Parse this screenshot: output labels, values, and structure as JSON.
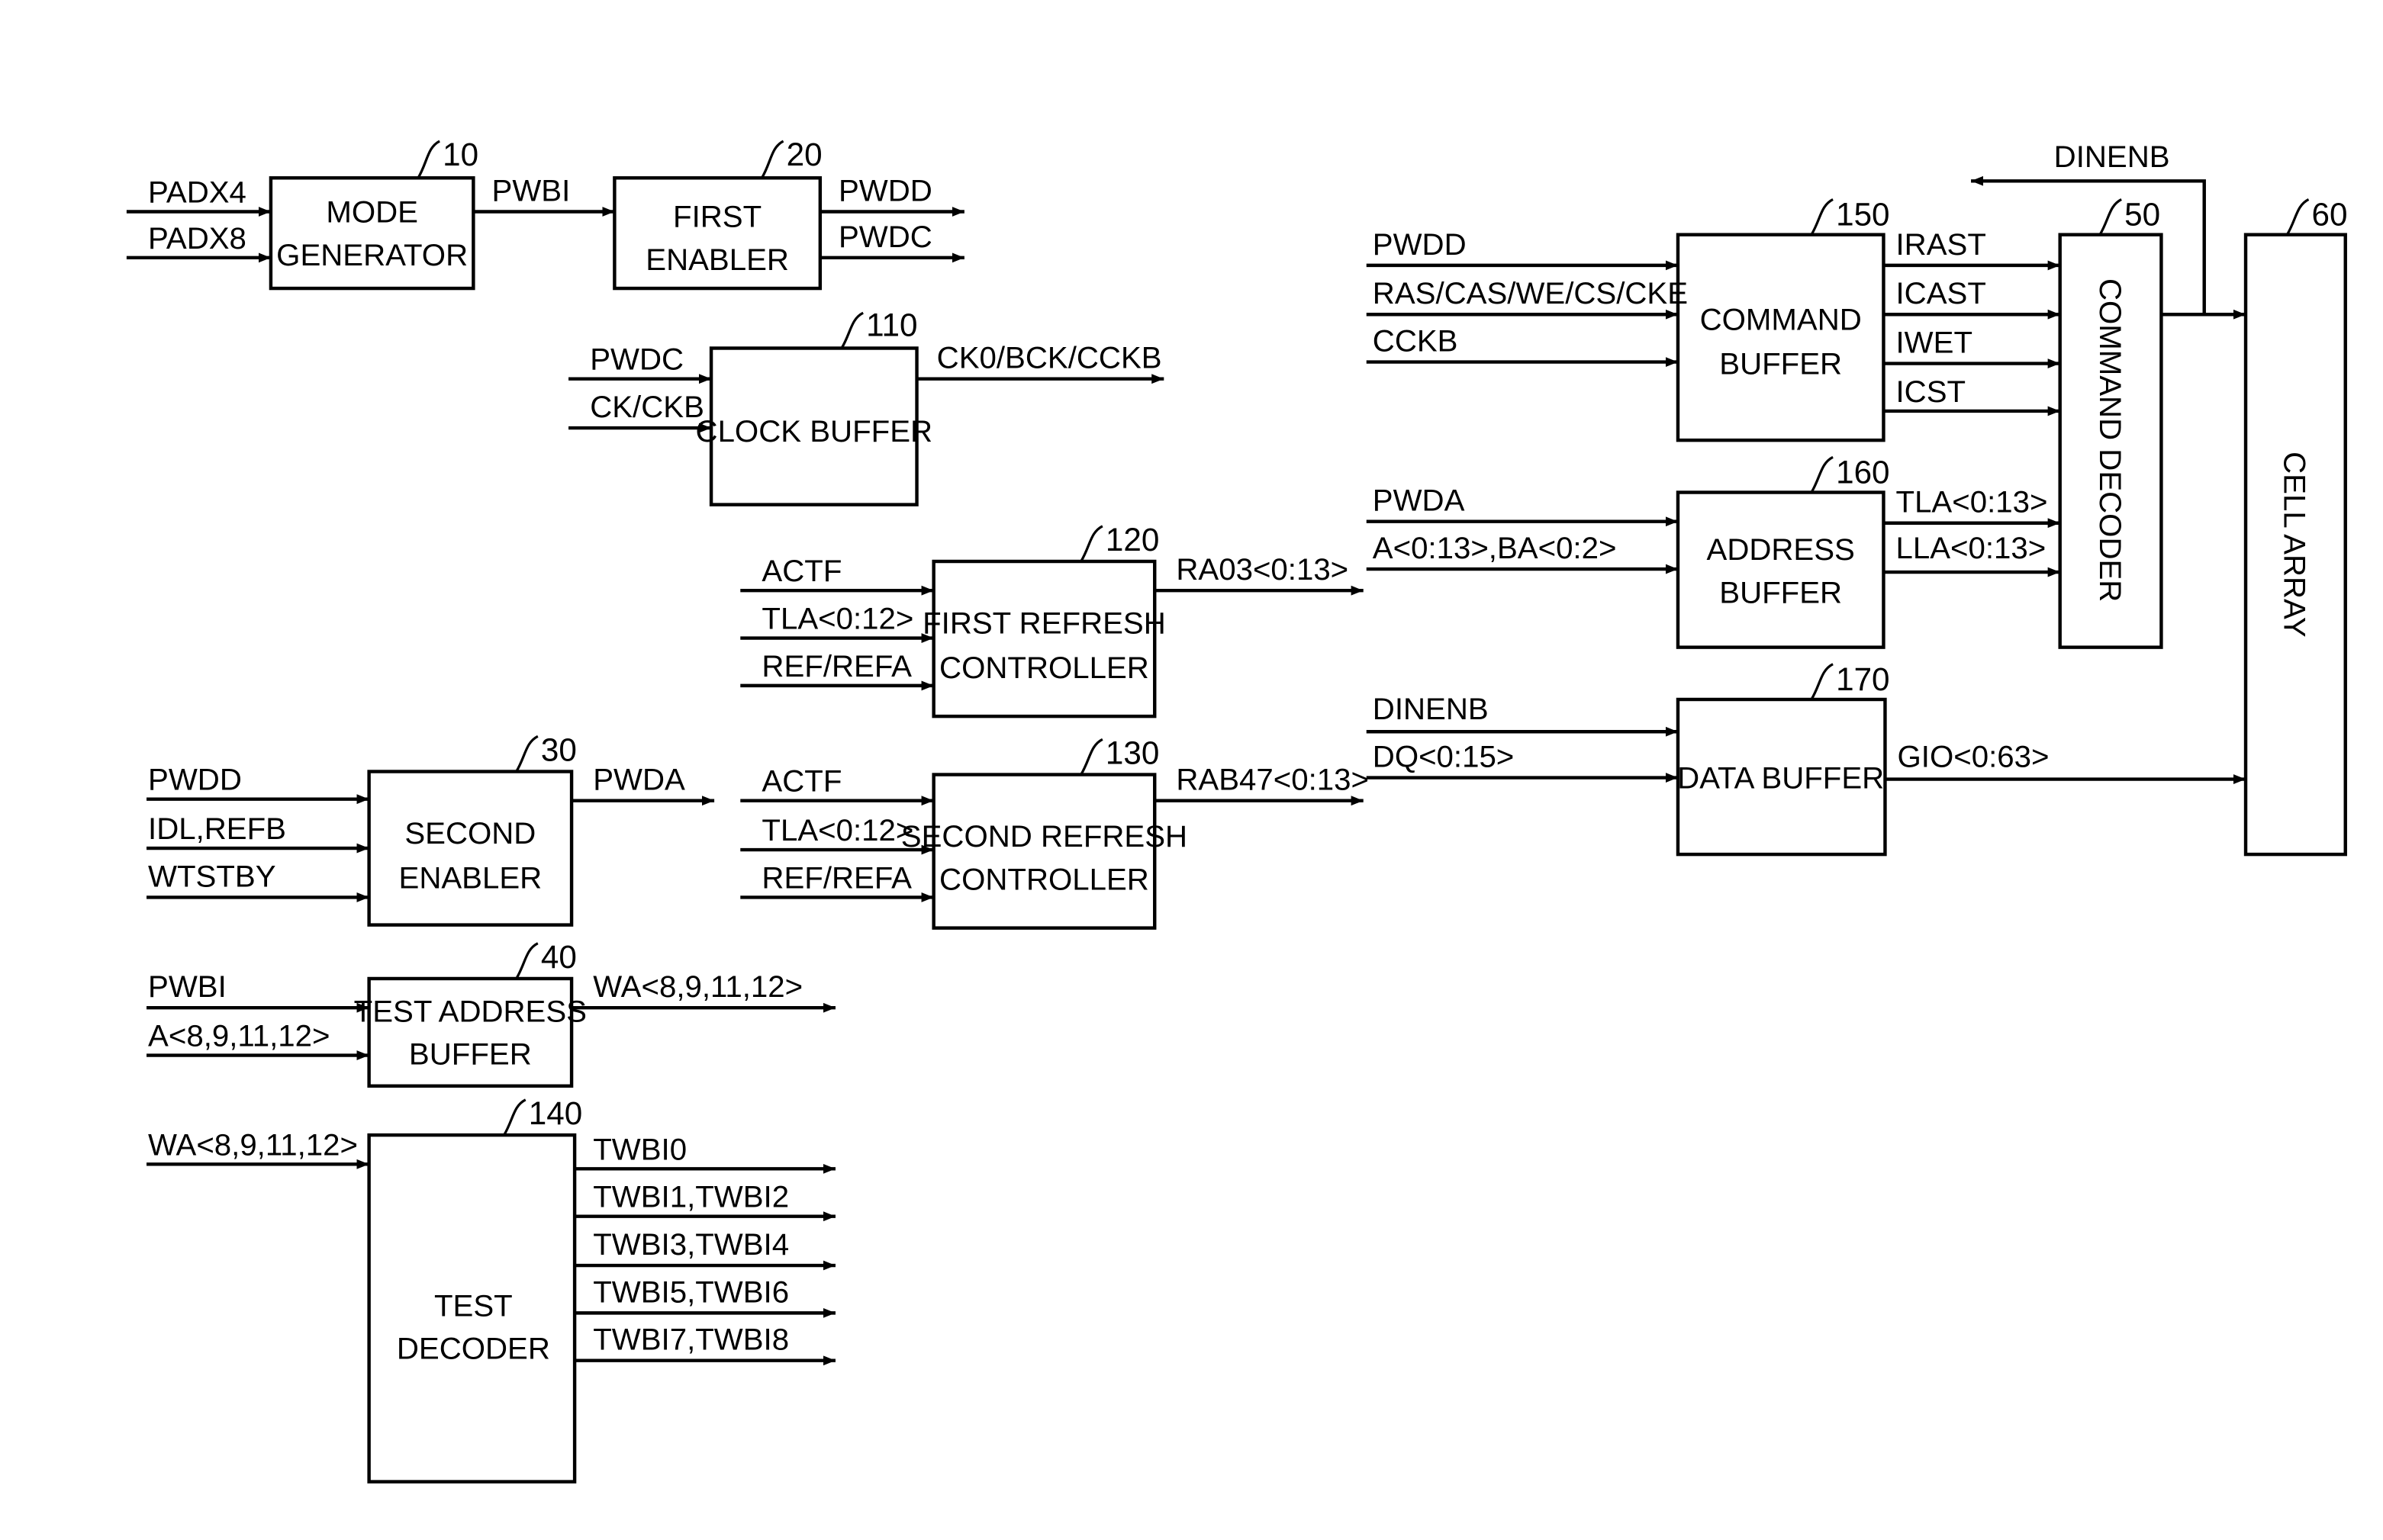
{
  "figure": {
    "blocks": [
      {
        "id": "10",
        "lines": [
          "MODE",
          "GENERATOR"
        ]
      },
      {
        "id": "20",
        "lines": [
          "FIRST",
          "ENABLER"
        ]
      },
      {
        "id": "110",
        "lines": [
          "CLOCK BUFFER"
        ]
      },
      {
        "id": "120",
        "lines": [
          "FIRST REFRESH",
          "CONTROLLER"
        ]
      },
      {
        "id": "130",
        "lines": [
          "SECOND REFRESH",
          "CONTROLLER"
        ]
      },
      {
        "id": "30",
        "lines": [
          "SECOND",
          "ENABLER"
        ]
      },
      {
        "id": "40",
        "lines": [
          "TEST ADDRESS",
          "BUFFER"
        ]
      },
      {
        "id": "140",
        "lines": [
          "TEST",
          "DECODER"
        ]
      },
      {
        "id": "150",
        "lines": [
          "COMMAND",
          "BUFFER"
        ]
      },
      {
        "id": "160",
        "lines": [
          "ADDRESS",
          "BUFFER"
        ]
      },
      {
        "id": "170",
        "lines": [
          "DATA BUFFER"
        ]
      },
      {
        "id": "50",
        "lines": [
          "COMMAND DECODER"
        ]
      },
      {
        "id": "60",
        "lines": [
          "CELL ARRAY"
        ]
      }
    ],
    "signals": {
      "padx4": "PADX4",
      "padx8": "PADX8",
      "pwbi": "PWBI",
      "pwdd": "PWDD",
      "pwdc": "PWDC",
      "ck_pwdc": "PWDC",
      "ck_ckb": "CK/CKB",
      "ck_out": "CK0/BCK/CCKB",
      "r1_actf": "ACTF",
      "r1_tla": "TLA<0:12>",
      "r1_ref": "REF/REFA",
      "r1_out": "RA03<0:13>",
      "r2_actf": "ACTF",
      "r2_tla": "TLA<0:12>",
      "r2_ref": "REF/REFA",
      "r2_out": "RAB47<0:13>",
      "se_pwdd": "PWDD",
      "se_idl": "IDL,REFB",
      "se_wtstby": "WTSTBY",
      "se_out": "PWDA",
      "ta_pwbi": "PWBI",
      "ta_a": "A<8,9,11,12>",
      "ta_out": "WA<8,9,11,12>",
      "td_in": "WA<8,9,11,12>",
      "td_out": [
        "TWBI0",
        "TWBI1,TWBI2",
        "TWBI3,TWBI4",
        "TWBI5,TWBI6",
        "TWBI7,TWBI8"
      ],
      "cb_pwdd": "PWDD",
      "cb_ras": "RAS/CAS/WE/CS/CKE",
      "cb_cckb": "CCKB",
      "cb_out": [
        "IRAST",
        "ICAST",
        "IWET",
        "ICST"
      ],
      "ab_pwda": "PWDA",
      "ab_a": "A<0:13>,BA<0:2>",
      "ab_out": [
        "TLA<0:13>",
        "LLA<0:13>"
      ],
      "db_dinenb": "DINENB",
      "db_dq": "DQ<0:15>",
      "db_out": "GIO<0:63>",
      "feedback": "DINENB"
    }
  }
}
